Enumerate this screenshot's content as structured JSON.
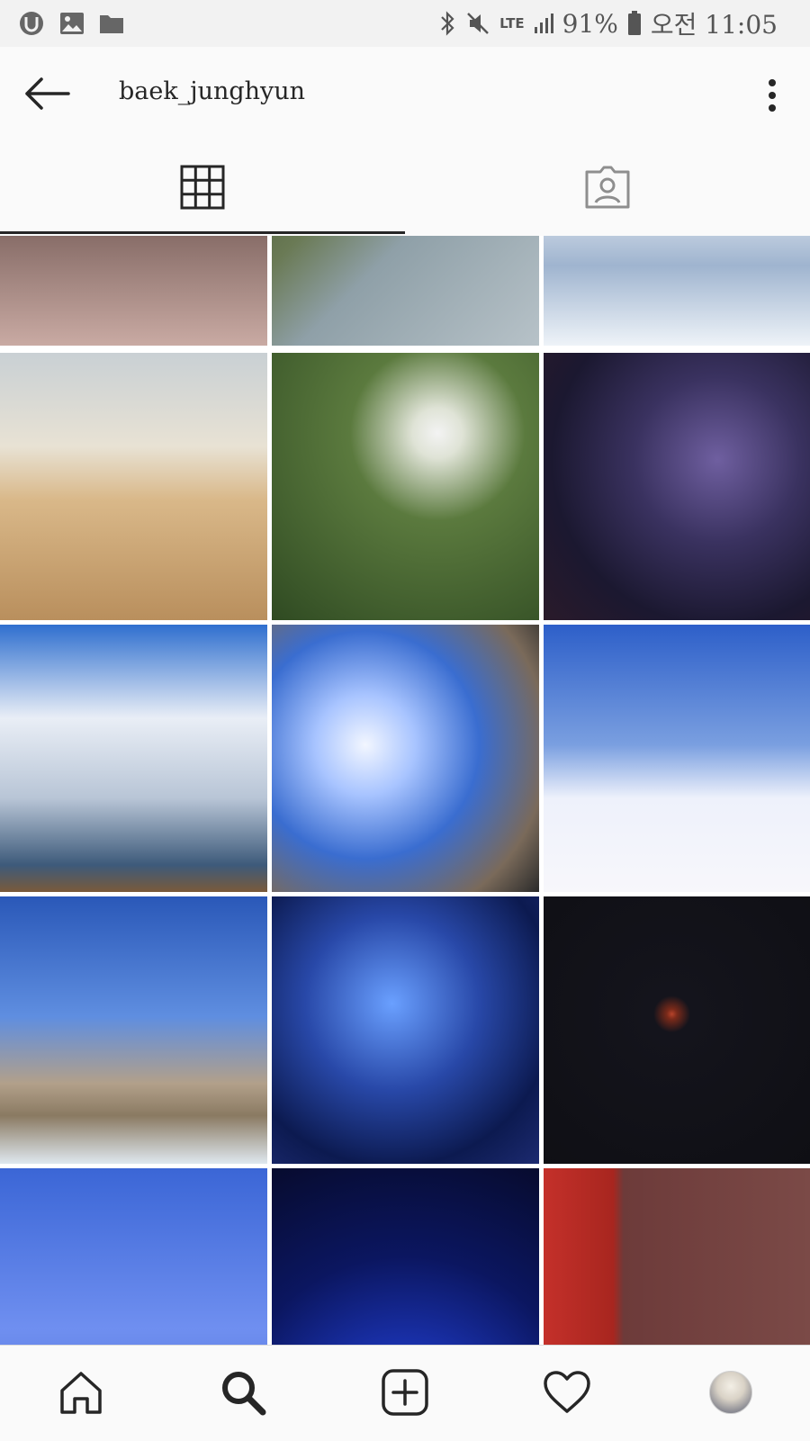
{
  "status_bar": {
    "left_icons": [
      "app-u-icon",
      "gallery-icon",
      "folder-icon"
    ],
    "right_icons": [
      "bluetooth-icon",
      "mute-icon"
    ],
    "network": "LTE",
    "battery": "91%",
    "time": "오전 11:05"
  },
  "header": {
    "back_icon": "back-arrow-icon",
    "username": "baek_junghyun",
    "more_icon": "more-vertical-icon"
  },
  "tabs": [
    {
      "name": "grid",
      "icon": "grid-icon",
      "active": true
    },
    {
      "name": "tagged",
      "icon": "tagged-icon",
      "active": false
    }
  ],
  "grid": {
    "columns": 3,
    "tiles": [
      {
        "name": "photo-lake-dusk"
      },
      {
        "name": "photo-sea-cliffs"
      },
      {
        "name": "photo-snowy-valley"
      },
      {
        "name": "photo-desert-dunes"
      },
      {
        "name": "photo-dandelion"
      },
      {
        "name": "photo-milky-way-camera"
      },
      {
        "name": "photo-cloudy-sky"
      },
      {
        "name": "photo-flags"
      },
      {
        "name": "photo-salt-flat-sky"
      },
      {
        "name": "photo-volcano-person"
      },
      {
        "name": "photo-starry-night-person"
      },
      {
        "name": "photo-red-moon"
      },
      {
        "name": "photo-light-painting"
      },
      {
        "name": "photo-starry-sky-glow"
      },
      {
        "name": "photo-red-wall-doorway"
      }
    ]
  },
  "bottom_nav": [
    {
      "name": "home",
      "icon": "home-icon"
    },
    {
      "name": "search",
      "icon": "search-icon",
      "active": true
    },
    {
      "name": "new-post",
      "icon": "add-post-icon"
    },
    {
      "name": "activity",
      "icon": "heart-icon"
    },
    {
      "name": "profile",
      "icon": "profile-avatar"
    }
  ],
  "colors": {
    "text_primary": "#262626",
    "status_text": "#555555",
    "background": "#fafafa",
    "divider": "#dbdbdb"
  }
}
